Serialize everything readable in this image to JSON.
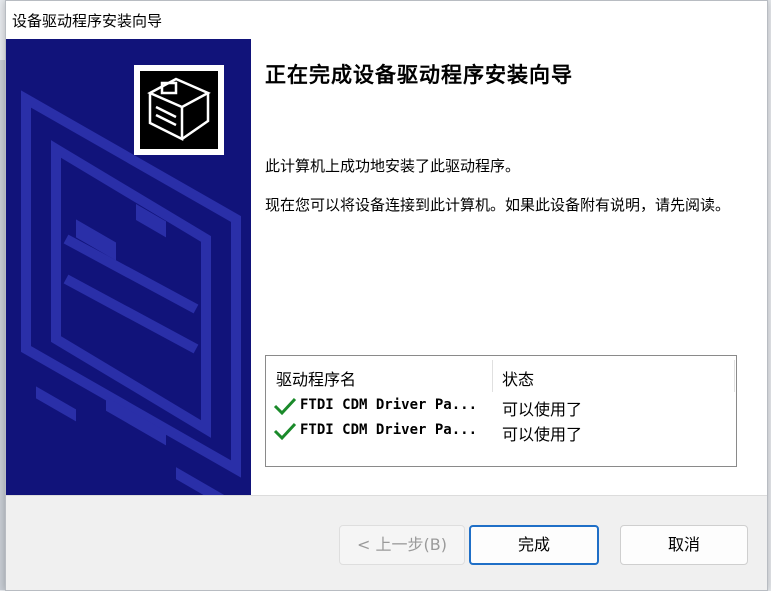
{
  "window": {
    "title": "设备驱动程序安装向导"
  },
  "main": {
    "heading": "正在完成设备驱动程序安装向导",
    "paragraph1": "此计算机上成功地安装了此驱动程序。",
    "paragraph2": "现在您可以将设备连接到此计算机。如果此设备附有说明，请先阅读。"
  },
  "driver_list": {
    "columns": [
      "驱动程序名",
      "状态"
    ],
    "rows": [
      {
        "name": "FTDI CDM Driver Pa...",
        "status": "可以使用了"
      },
      {
        "name": "FTDI CDM Driver Pa...",
        "status": "可以使用了"
      }
    ]
  },
  "buttons": {
    "back": "< 上一步(B)",
    "finish": "完成",
    "cancel": "取消"
  },
  "colors": {
    "banner": "#11137a",
    "check": "#1a8a2a",
    "focus_border": "#1f6fc7"
  },
  "icons": {
    "status": "green-check-icon",
    "wizard": "hardware-device-icon"
  }
}
